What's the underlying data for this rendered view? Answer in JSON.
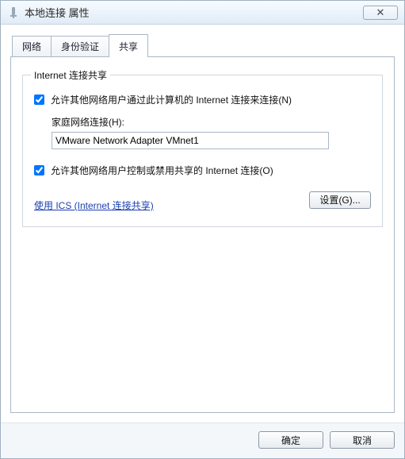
{
  "window": {
    "title": "本地连接 属性",
    "close_glyph": "✕"
  },
  "tabs": [
    {
      "label": "网络"
    },
    {
      "label": "身份验证"
    },
    {
      "label": "共享"
    }
  ],
  "group": {
    "title": "Internet 连接共享",
    "allow_share": {
      "checked": true,
      "label": "允许其他网络用户通过此计算机的 Internet 连接来连接(N)"
    },
    "home_net": {
      "label": "家庭网络连接(H):",
      "value": "VMware Network Adapter VMnet1"
    },
    "allow_control": {
      "checked": true,
      "label": "允许其他网络用户控制或禁用共享的 Internet 连接(O)"
    },
    "link_label": "使用 ICS (Internet 连接共享)",
    "settings_button": "设置(G)..."
  },
  "footer": {
    "ok": "确定",
    "cancel": "取消"
  }
}
